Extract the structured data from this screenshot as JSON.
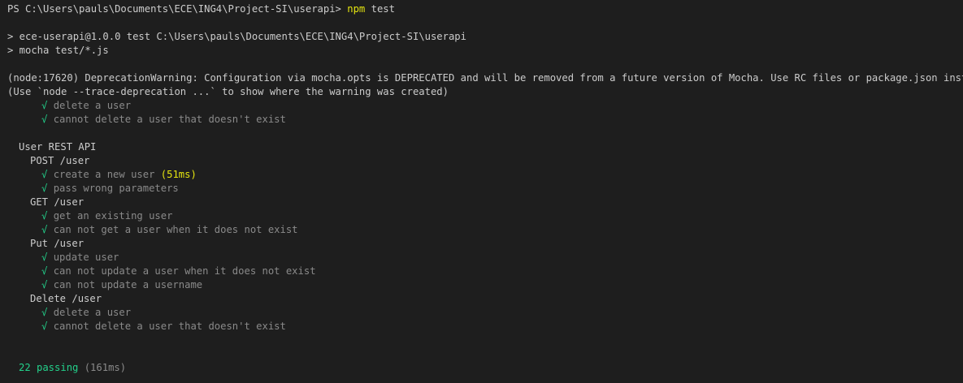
{
  "prompt": {
    "ps_path": "PS C:\\Users\\pauls\\Documents\\ECE\\ING4\\Project-SI\\userapi> ",
    "command": "npm",
    "argument": " test"
  },
  "npm_header": {
    "line1": "> ece-userapi@1.0.0 test C:\\Users\\pauls\\Documents\\ECE\\ING4\\Project-SI\\userapi",
    "line2": "> mocha test/*.js"
  },
  "warning": {
    "line1": "(node:17620) DeprecationWarning: Configuration via mocha.opts is DEPRECATED and will be removed from a future version of Mocha. Use RC files or package.json instead.",
    "line2": "(Use `node --trace-deprecation ...` to show where the warning was created)"
  },
  "check_mark": "√",
  "early_tests": [
    "delete a user",
    "cannot delete a user that doesn't exist"
  ],
  "suite": {
    "title": "User REST API",
    "groups": [
      {
        "name": "POST /user",
        "tests": [
          {
            "label": "create a new user",
            "duration": "(51ms)"
          },
          {
            "label": "pass wrong parameters"
          }
        ]
      },
      {
        "name": "GET /user",
        "tests": [
          {
            "label": "get an existing user"
          },
          {
            "label": "can not get a user when it does not exist"
          }
        ]
      },
      {
        "name": "Put /user",
        "tests": [
          {
            "label": "update user"
          },
          {
            "label": "can not update a user when it does not exist"
          },
          {
            "label": "can not update a username"
          }
        ]
      },
      {
        "name": "Delete /user",
        "tests": [
          {
            "label": "delete a user"
          },
          {
            "label": "cannot delete a user that doesn't exist"
          }
        ]
      }
    ]
  },
  "summary": {
    "passing": "22 passing",
    "time": "(161ms)"
  },
  "colors": {
    "background": "#1e1e1e",
    "text": "#cccccc",
    "command": "#e5e510",
    "pass": "#23d18b",
    "test_label": "#8a8a8a",
    "duration": "#e5e510"
  }
}
